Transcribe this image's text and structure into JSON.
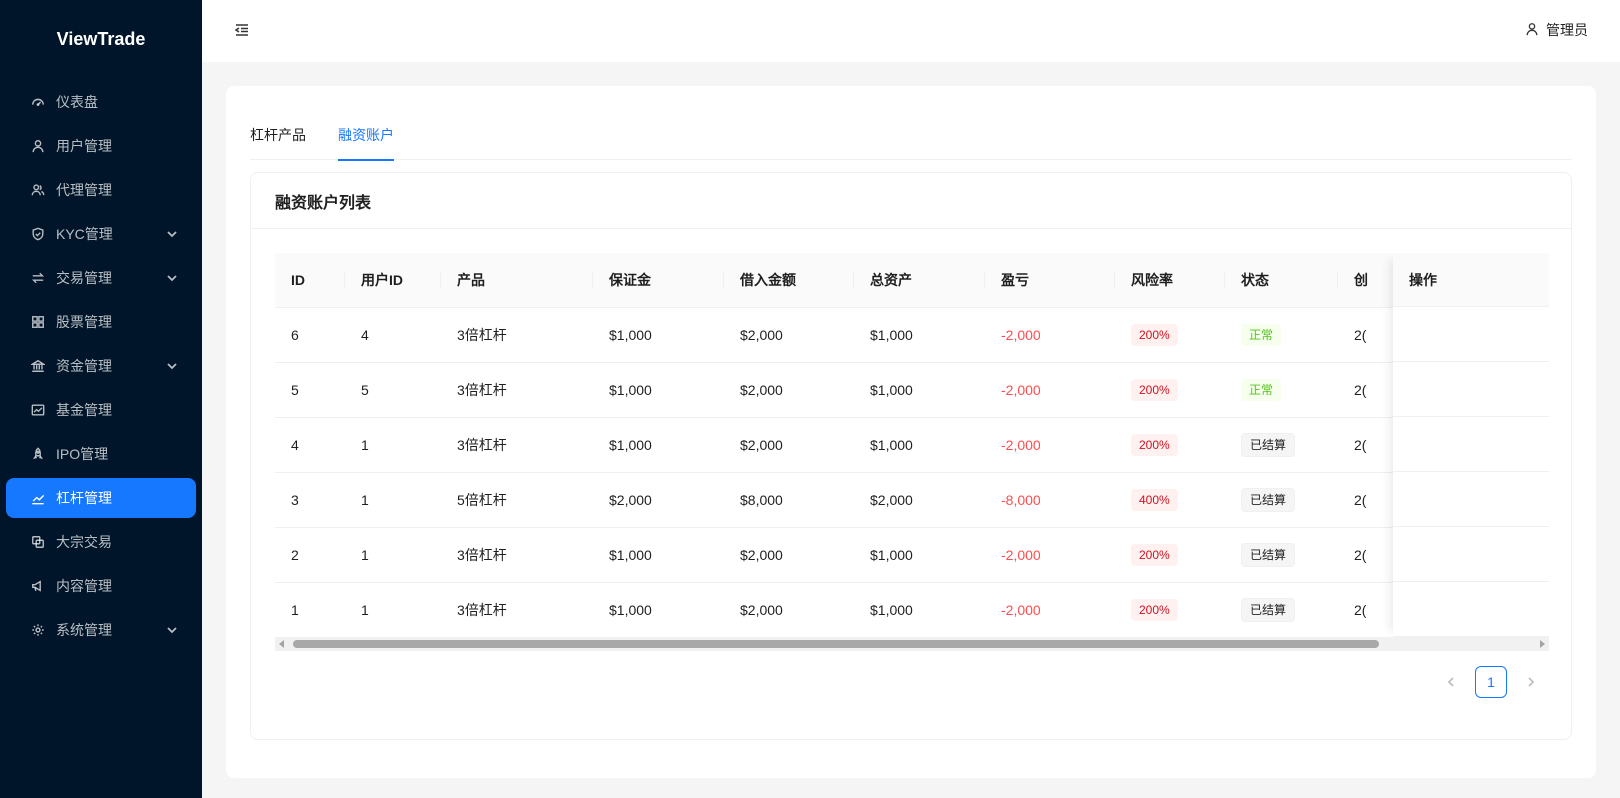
{
  "brand": "ViewTrade",
  "sidebar": {
    "items": [
      {
        "label": "仪表盘",
        "icon": "dashboard-icon",
        "submenu": false,
        "active": false
      },
      {
        "label": "用户管理",
        "icon": "user-icon",
        "submenu": false,
        "active": false
      },
      {
        "label": "代理管理",
        "icon": "team-icon",
        "submenu": false,
        "active": false
      },
      {
        "label": "KYC管理",
        "icon": "shield-icon",
        "submenu": true,
        "active": false
      },
      {
        "label": "交易管理",
        "icon": "swap-icon",
        "submenu": true,
        "active": false
      },
      {
        "label": "股票管理",
        "icon": "grid-icon",
        "submenu": false,
        "active": false
      },
      {
        "label": "资金管理",
        "icon": "bank-icon",
        "submenu": true,
        "active": false
      },
      {
        "label": "基金管理",
        "icon": "fund-icon",
        "submenu": false,
        "active": false
      },
      {
        "label": "IPO管理",
        "icon": "rocket-icon",
        "submenu": false,
        "active": false
      },
      {
        "label": "杠杆管理",
        "icon": "stock-line-icon",
        "submenu": false,
        "active": true
      },
      {
        "label": "大宗交易",
        "icon": "copy-icon",
        "submenu": false,
        "active": false
      },
      {
        "label": "内容管理",
        "icon": "notification-icon",
        "submenu": false,
        "active": false
      },
      {
        "label": "系统管理",
        "icon": "setting-icon",
        "submenu": true,
        "active": false
      }
    ]
  },
  "header": {
    "user_label": "管理员"
  },
  "tabs": [
    {
      "label": "杠杆产品",
      "active": false
    },
    {
      "label": "融资账户",
      "active": true
    }
  ],
  "card": {
    "title": "融资账户列表"
  },
  "table": {
    "columns": [
      "ID",
      "用户ID",
      "产品",
      "保证金",
      "借入金额",
      "总资产",
      "盈亏",
      "风险率",
      "状态",
      "创"
    ],
    "fixed_column": "操作",
    "rows": [
      [
        "6",
        "4",
        "3倍杠杆",
        "$1,000",
        "$2,000",
        "$1,000",
        "-2,000",
        "200%",
        "正常",
        "2("
      ],
      [
        "5",
        "5",
        "3倍杠杆",
        "$1,000",
        "$2,000",
        "$1,000",
        "-2,000",
        "200%",
        "正常",
        "2("
      ],
      [
        "4",
        "1",
        "3倍杠杆",
        "$1,000",
        "$2,000",
        "$1,000",
        "-2,000",
        "200%",
        "已结算",
        "2("
      ],
      [
        "3",
        "1",
        "5倍杠杆",
        "$2,000",
        "$8,000",
        "$2,000",
        "-8,000",
        "400%",
        "已结算",
        "2("
      ],
      [
        "2",
        "1",
        "3倍杠杆",
        "$1,000",
        "$2,000",
        "$1,000",
        "-2,000",
        "200%",
        "已结算",
        "2("
      ],
      [
        "1",
        "1",
        "3倍杠杆",
        "$1,000",
        "$2,000",
        "$1,000",
        "-2,000",
        "200%",
        "已结算",
        "2("
      ]
    ]
  },
  "pagination": {
    "current": "1"
  },
  "colors": {
    "primary": "#1677ff",
    "sidebar_bg": "#001529",
    "negative": "#ff4d4f",
    "success": "#52c41a"
  }
}
